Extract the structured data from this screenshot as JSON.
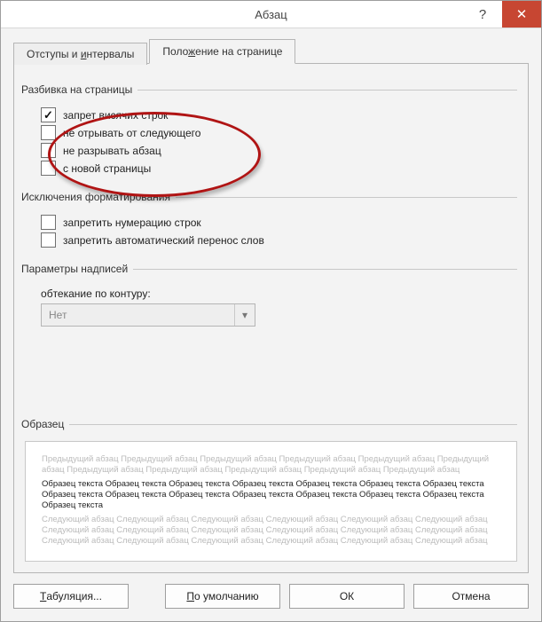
{
  "window": {
    "title": "Абзац"
  },
  "titlebar": {
    "help_glyph": "?",
    "close_glyph": "✕"
  },
  "tabs": {
    "indents": {
      "pre": "Отступы и ",
      "mn": "и",
      "post": "нтервалы"
    },
    "position": {
      "pre": "Поло",
      "mn": "ж",
      "post": "ение на странице"
    }
  },
  "groups": {
    "pagination": {
      "legend": "Разбивка на страницы",
      "items": [
        {
          "mn": "з",
          "post": "апрет висячих строк",
          "checked": true
        },
        {
          "mn": "н",
          "post": "е отрывать от следующего",
          "checked": false
        },
        {
          "mn": "н",
          "post": "е разрывать абзац",
          "checked": false
        },
        {
          "mn": "с",
          "post": " новой страницы",
          "checked": false
        }
      ]
    },
    "exceptions": {
      "legend": "Исключения форматирования",
      "items": [
        {
          "mn": "з",
          "post": "апретить нумерацию строк",
          "checked": false
        },
        {
          "mn": "з",
          "post": "апретить автоматический перенос слов",
          "checked": false
        }
      ]
    },
    "textbox": {
      "legend": "Параметры надписей",
      "wrap_pre": "о",
      "wrap_mn": "б",
      "wrap_post": "текание по контуру:",
      "select_value": "Нет"
    },
    "sample": {
      "legend": "Образец",
      "prev": "Предыдущий абзац Предыдущий абзац Предыдущий абзац Предыдущий абзац Предыдущий абзац Предыдущий абзац Предыдущий абзац Предыдущий абзац Предыдущий абзац Предыдущий абзац Предыдущий абзац",
      "cur": "Образец текста Образец текста Образец текста Образец текста Образец текста Образец текста Образец текста Образец текста Образец текста Образец текста Образец текста Образец текста Образец текста Образец текста Образец текста",
      "next": "Следующий абзац Следующий абзац Следующий абзац Следующий абзац Следующий абзац Следующий абзац Следующий абзац Следующий абзац Следующий абзац Следующий абзац Следующий абзац Следующий абзац Следующий абзац Следующий абзац Следующий абзац Следующий абзац Следующий абзац Следующий абзац"
    }
  },
  "buttons": {
    "tabs": {
      "mn": "Т",
      "post": "абуляция..."
    },
    "default": {
      "mn": "П",
      "post": "о умолчанию"
    },
    "ok": "ОК",
    "cancel": "Отмена"
  },
  "icons": {
    "dropdown_glyph": "▾"
  }
}
